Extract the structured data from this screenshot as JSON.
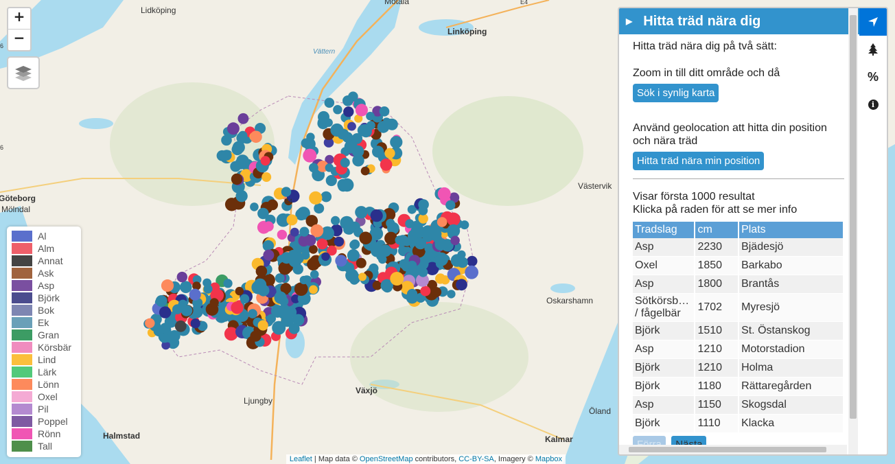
{
  "map": {
    "places": [
      "Lidköping",
      "Motala",
      "Linköping",
      "Vättern",
      "Göteborg",
      "Mölndal",
      "Västervik",
      "Oskarshamn",
      "Ljungby",
      "Växjö",
      "Halmstad",
      "Kalmar",
      "Öland",
      "E4",
      "E4",
      "6",
      "6"
    ],
    "zoom_in": "+",
    "zoom_out": "−"
  },
  "legend": [
    {
      "name": "Al",
      "color": "#5a6fcc"
    },
    {
      "name": "Alm",
      "color": "#ee5f6a"
    },
    {
      "name": "Annat",
      "color": "#444444"
    },
    {
      "name": "Ask",
      "color": "#a0633e"
    },
    {
      "name": "Asp",
      "color": "#7a4fa0"
    },
    {
      "name": "Björk",
      "color": "#4b4c8e"
    },
    {
      "name": "Bok",
      "color": "#7e86b2"
    },
    {
      "name": "Ek",
      "color": "#6aa0b8"
    },
    {
      "name": "Gran",
      "color": "#3c9c64"
    },
    {
      "name": "Körsbär",
      "color": "#f08cbf"
    },
    {
      "name": "Lind",
      "color": "#fbbf3c"
    },
    {
      "name": "Lärk",
      "color": "#52c97a"
    },
    {
      "name": "Lönn",
      "color": "#fd8a5c"
    },
    {
      "name": "Oxel",
      "color": "#f4aad4"
    },
    {
      "name": "Pil",
      "color": "#b48ad0"
    },
    {
      "name": "Poppel",
      "color": "#7e5aa2"
    },
    {
      "name": "Rönn",
      "color": "#f055b4"
    },
    {
      "name": "Tall",
      "color": "#4e8f4a"
    }
  ],
  "attribution": {
    "leaflet": "Leaflet",
    "sep": " | Map data © ",
    "osm": "OpenStreetMap",
    "contrib": " contributors, ",
    "license": "CC-BY-SA",
    "imagery": ", Imagery © ",
    "mapbox": "Mapbox"
  },
  "sidebar": {
    "title": "Hitta träd nära dig",
    "intro": "Hitta träd nära dig på två sätt:",
    "zoom_text": "Zoom in till ditt område och då",
    "search_button": "Sök i synlig karta",
    "geo_text": "Använd geolocation att hitta din position och nära träd",
    "geo_button": "Hitta träd nära min position",
    "results_line1": "Visar första 1000 resultat",
    "results_line2": "Klicka på raden för att se mer info",
    "table": {
      "headers": [
        "Tradslag",
        "cm",
        "Plats"
      ],
      "rows": [
        [
          "Asp",
          "2230",
          "Bjädesjö"
        ],
        [
          "Oxel",
          "1850",
          "Barkabo"
        ],
        [
          "Asp",
          "1800",
          "Brantås"
        ],
        [
          "Sötkörsb… / fågelbär",
          "1702",
          "Myresjö"
        ],
        [
          "Björk",
          "1510",
          "St. Östanskog"
        ],
        [
          "Asp",
          "1210",
          "Motorstadion"
        ],
        [
          "Björk",
          "1210",
          "Holma"
        ],
        [
          "Björk",
          "1180",
          "Rättaregården"
        ],
        [
          "Asp",
          "1150",
          "Skogsdal"
        ],
        [
          "Björk",
          "1110",
          "Klacka"
        ]
      ]
    },
    "prev_button": "Förra",
    "next_button": "Nästa"
  },
  "tabs": [
    "locate-arrow-icon",
    "tree-icon",
    "percent-icon",
    "info-icon"
  ],
  "tab_percent": "%",
  "tab_info": "i"
}
